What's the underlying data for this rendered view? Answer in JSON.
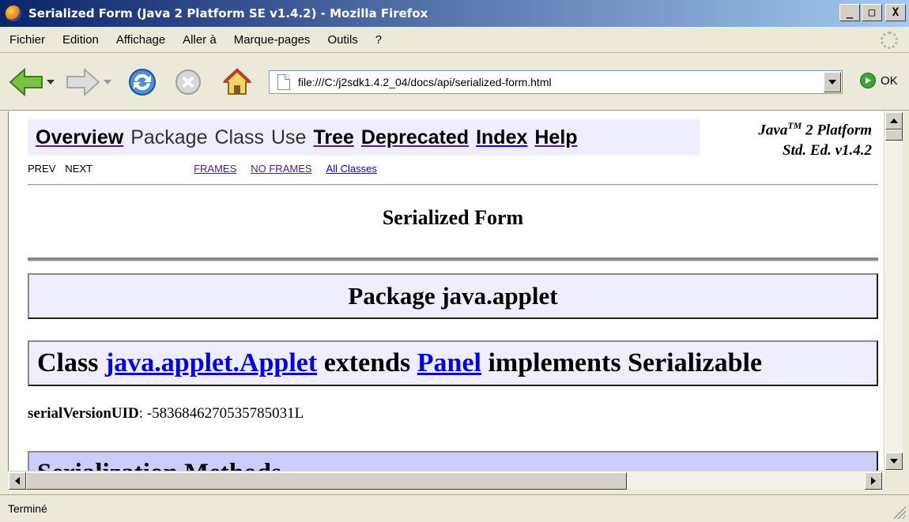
{
  "window": {
    "title": "Serialized Form (Java 2 Platform SE v1.4.2) - Mozilla Firefox",
    "min_label": "_",
    "max_label": "□",
    "close_label": "X"
  },
  "menu": {
    "items": [
      "Fichier",
      "Edition",
      "Affichage",
      "Aller à",
      "Marque-pages",
      "Outils",
      "?"
    ]
  },
  "toolbar": {
    "url": "file:///C:/j2sdk1.4.2_04/docs/api/serialized-form.html",
    "go_label": "OK"
  },
  "javadoc": {
    "nav": {
      "overview": "Overview",
      "package": "Package",
      "class": "Class",
      "use": "Use",
      "tree": "Tree",
      "deprecated": "Deprecated",
      "index": "Index",
      "help": "Help"
    },
    "platform_line1": "Java",
    "platform_tm": "TM",
    "platform_line1_rest": " 2 Platform",
    "platform_line2": "Std. Ed. v1.4.2",
    "subnav": {
      "prev": "PREV",
      "next": "NEXT",
      "frames": "FRAMES",
      "no_frames": "NO FRAMES",
      "all_classes": "All Classes"
    },
    "heading": "Serialized Form",
    "package_title": "Package java.applet",
    "class_prefix": "Class ",
    "class_link": "java.applet.Applet",
    "class_mid": " extends ",
    "class_super_link": "Panel",
    "class_suffix": " implements Serializable",
    "serial_label": "serialVersionUID",
    "serial_value": ": -5836846270535785031L",
    "methods_title": "Serialization Methods"
  },
  "status": {
    "text": "Terminé"
  },
  "colors": {
    "titlebar": "#0a246a",
    "nav_bg": "#eeeeff",
    "methods_bg": "#ccccff",
    "link_visited": "#551a8b",
    "link": "#0000ee"
  }
}
